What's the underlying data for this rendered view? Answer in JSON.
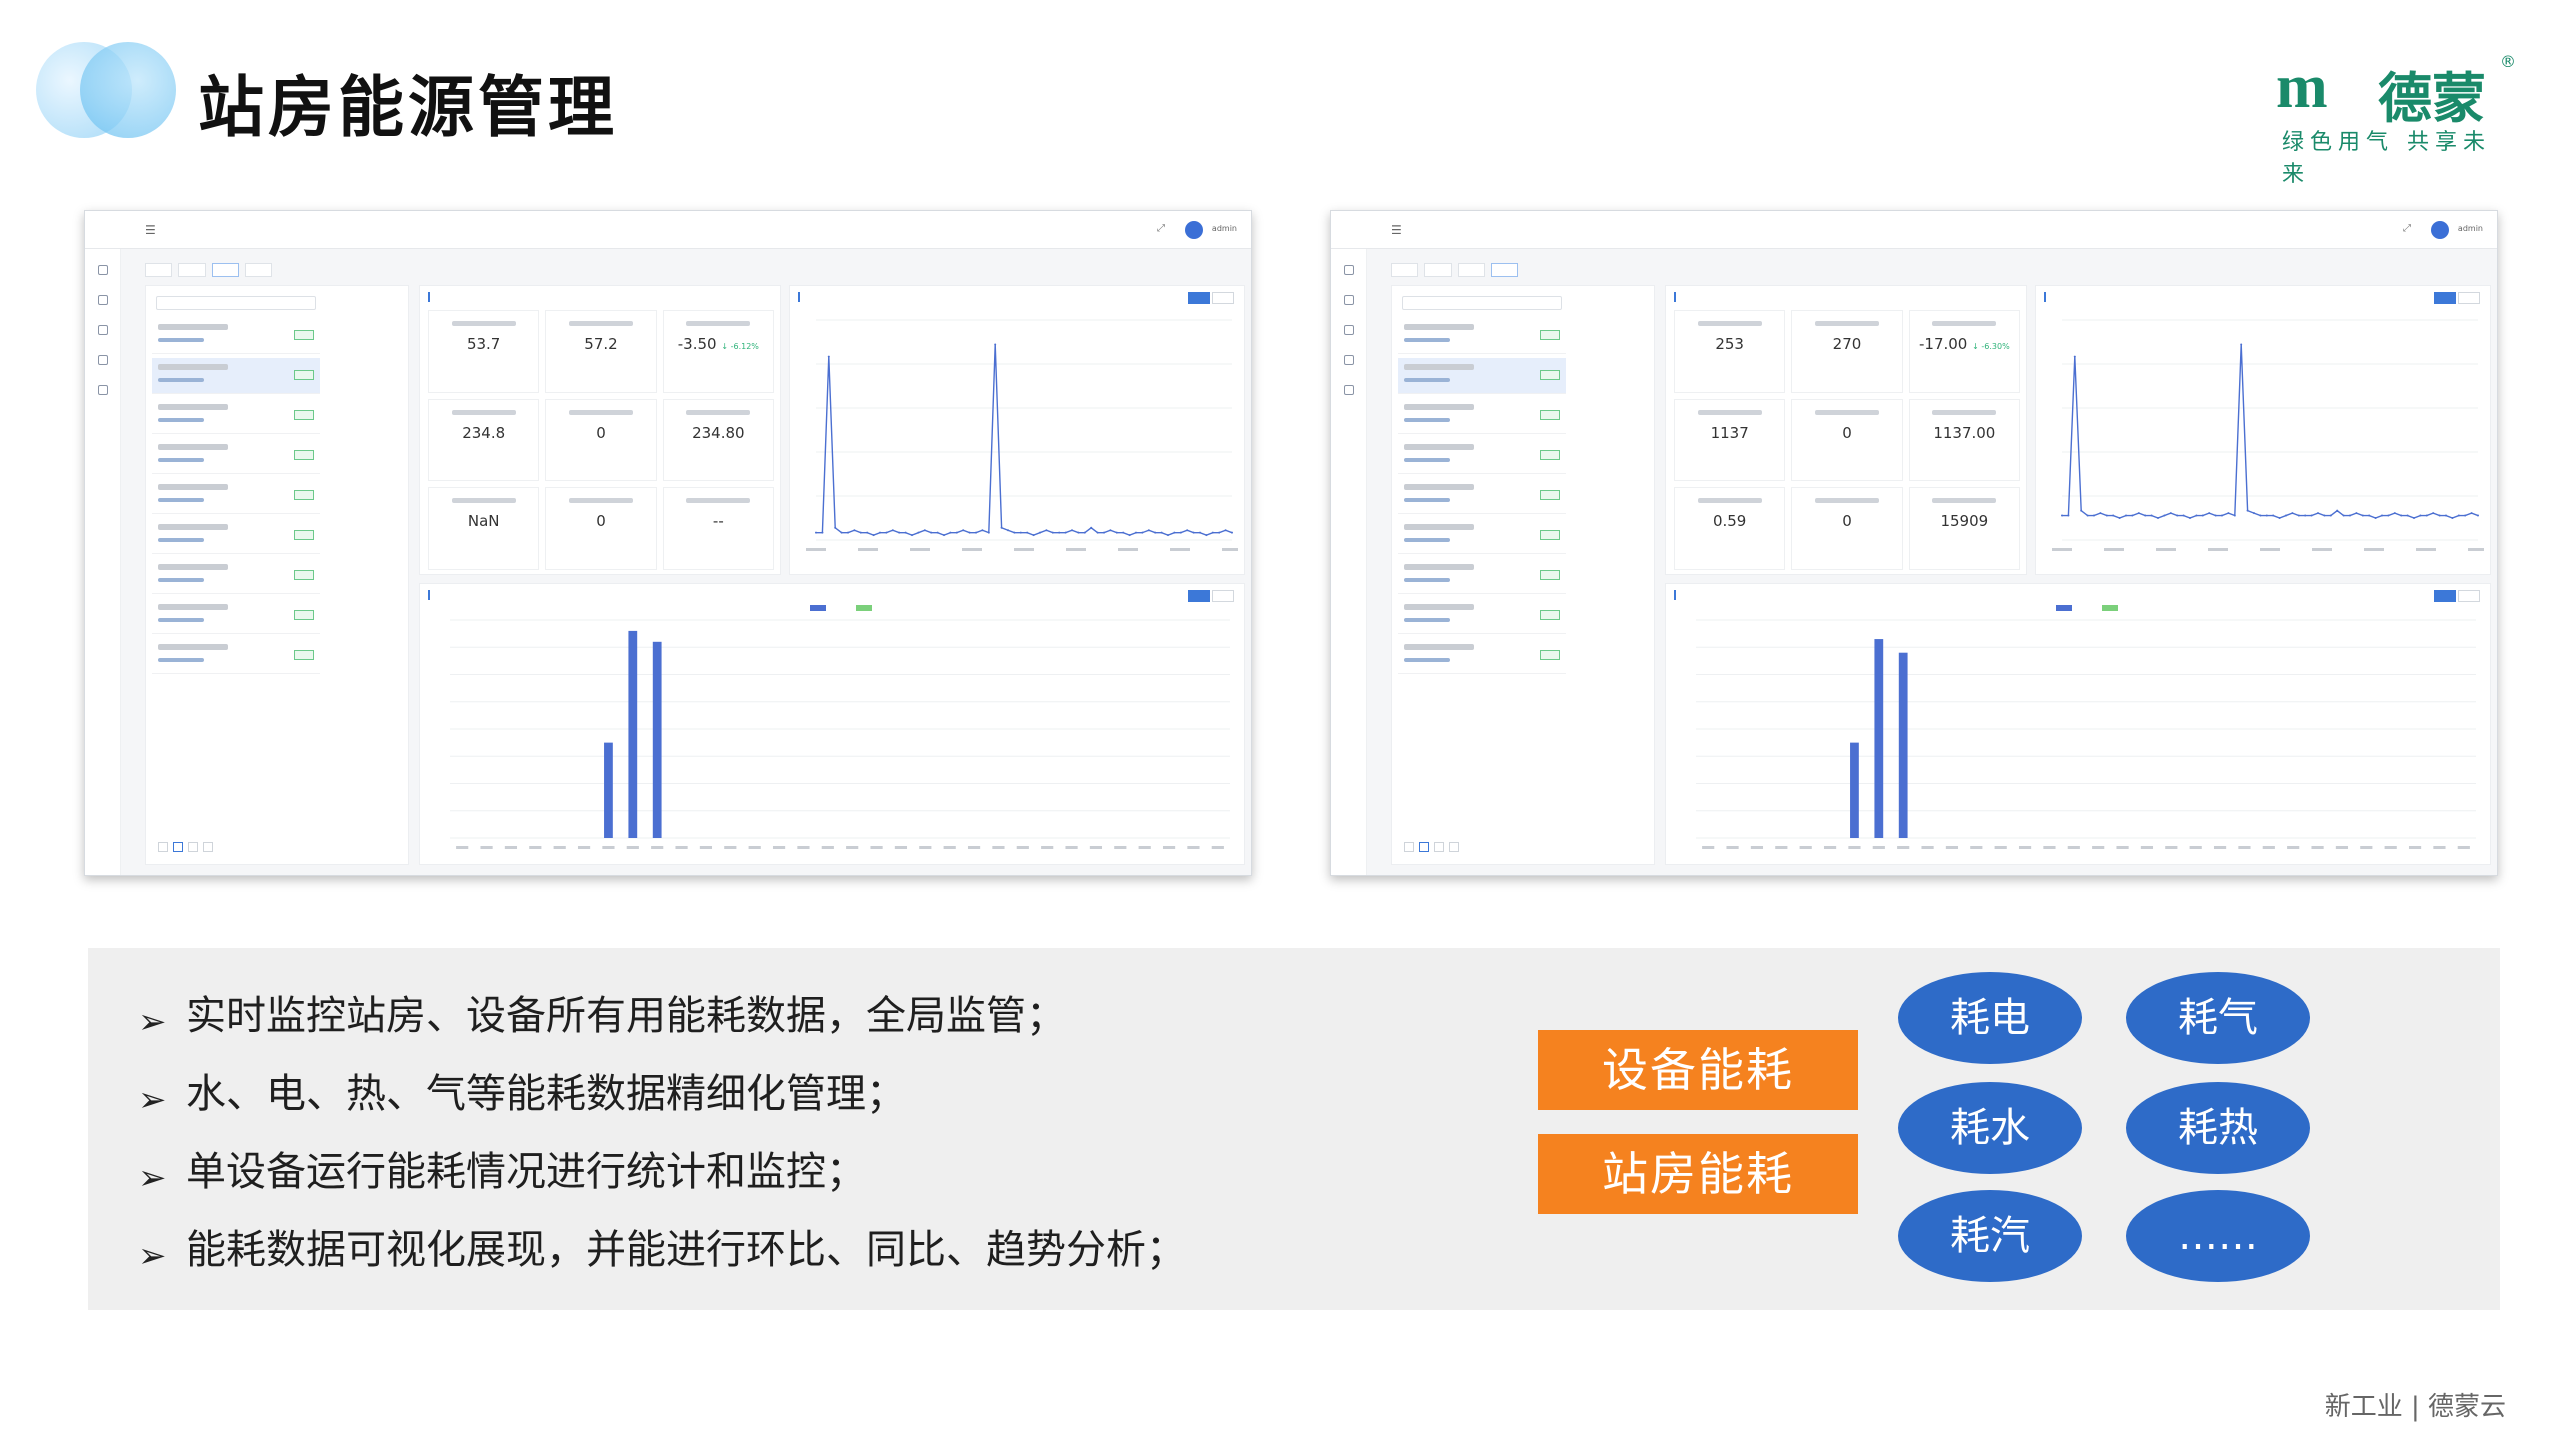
{
  "header": {
    "title": "站房能源管理"
  },
  "logo": {
    "name": "德蒙",
    "reg": "®",
    "slogan": "绿色用气 共享未来"
  },
  "shots": [
    {
      "admin": "admin",
      "kpi_values": [
        "53.7",
        "57.2",
        "-3.50",
        "234.8",
        "0",
        "234.80",
        "NaN",
        "0",
        "--"
      ],
      "kpi_change": "↓ -6.12%"
    },
    {
      "admin": "admin",
      "kpi_values": [
        "253",
        "270",
        "-17.00",
        "1137",
        "0",
        "1137.00",
        "0.59",
        "0",
        "15909"
      ],
      "kpi_change": "↓ -6.30%"
    }
  ],
  "bullets": [
    "实时监控站房、设备所有用能耗数据，全局监管；",
    "水、电、热、气等能耗数据精细化管理；",
    "单设备运行能耗情况进行统计和监控；",
    "能耗数据可视化展现，并能进行环比、同比、趋势分析；"
  ],
  "categories": {
    "primary": "设备能耗",
    "secondary": "站房能耗"
  },
  "pills": [
    "耗电",
    "耗气",
    "耗水",
    "耗热",
    "耗汽",
    "……"
  ],
  "footer": "新工业 | 德蒙云",
  "colors": {
    "accent_orange": "#f5821f",
    "pill_blue": "#2e6bc8",
    "brand_green": "#1a8a6a",
    "chart_blue": "#4b6fd1",
    "chart_green": "#7bd07b"
  },
  "charts": {
    "trend_left": [
      3,
      3,
      75,
      5,
      3,
      3,
      4,
      3,
      3,
      2,
      3,
      3,
      4,
      3,
      3,
      2,
      3,
      4,
      3,
      3,
      2,
      3,
      3,
      4,
      3,
      3,
      4,
      3,
      80,
      5,
      4,
      3,
      3,
      3,
      2,
      3,
      4,
      3,
      3,
      3,
      4,
      3,
      3,
      5,
      3,
      3,
      4,
      3,
      3,
      2,
      3,
      3,
      4,
      3,
      3,
      2,
      3,
      3,
      4,
      3,
      3,
      2,
      3,
      3,
      4,
      3
    ],
    "trend_right": [
      10,
      10,
      75,
      12,
      10,
      10,
      11,
      10,
      10,
      9,
      10,
      10,
      11,
      10,
      10,
      9,
      10,
      11,
      10,
      10,
      9,
      10,
      10,
      11,
      10,
      10,
      11,
      10,
      80,
      12,
      11,
      10,
      10,
      10,
      9,
      10,
      11,
      10,
      10,
      10,
      11,
      10,
      10,
      12,
      10,
      10,
      11,
      10,
      10,
      9,
      10,
      10,
      11,
      10,
      10,
      9,
      10,
      10,
      11,
      10,
      10,
      9,
      10,
      10,
      11,
      10
    ],
    "bars_left": {
      "count": 32,
      "values": {
        "6": 35,
        "7": 76,
        "8": 72
      },
      "max": 80
    },
    "bars_right": {
      "count": 32,
      "values": {
        "6": 35,
        "7": 73,
        "8": 68
      },
      "max": 80
    }
  }
}
